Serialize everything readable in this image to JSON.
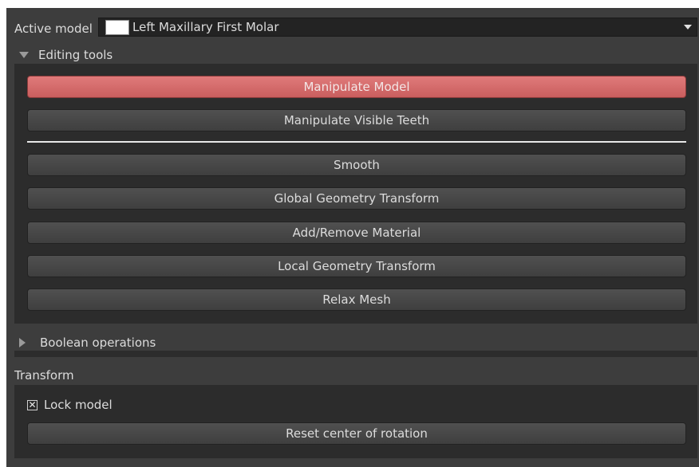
{
  "active_model": {
    "label": "Active model",
    "value": "Left Maxillary First Molar",
    "swatch_color": "#ffffff"
  },
  "editing_tools": {
    "header": "Editing tools",
    "expanded": true,
    "buttons": [
      {
        "label": "Manipulate Model",
        "active": true
      },
      {
        "label": "Manipulate Visible Teeth",
        "active": false
      },
      {
        "label": "Smooth",
        "active": false
      },
      {
        "label": "Global Geometry Transform",
        "active": false
      },
      {
        "label": "Add/Remove Material",
        "active": false
      },
      {
        "label": "Local Geometry Transform",
        "active": false
      },
      {
        "label": "Relax Mesh",
        "active": false
      }
    ]
  },
  "boolean_operations": {
    "header": "Boolean operations",
    "expanded": false
  },
  "transform": {
    "header": "Transform",
    "lock_model_label": "Lock model",
    "lock_model_checked": true,
    "reset_button": "Reset center of rotation"
  },
  "colors": {
    "active_button": "#d46c6c",
    "panel": "#3d3d3d"
  }
}
